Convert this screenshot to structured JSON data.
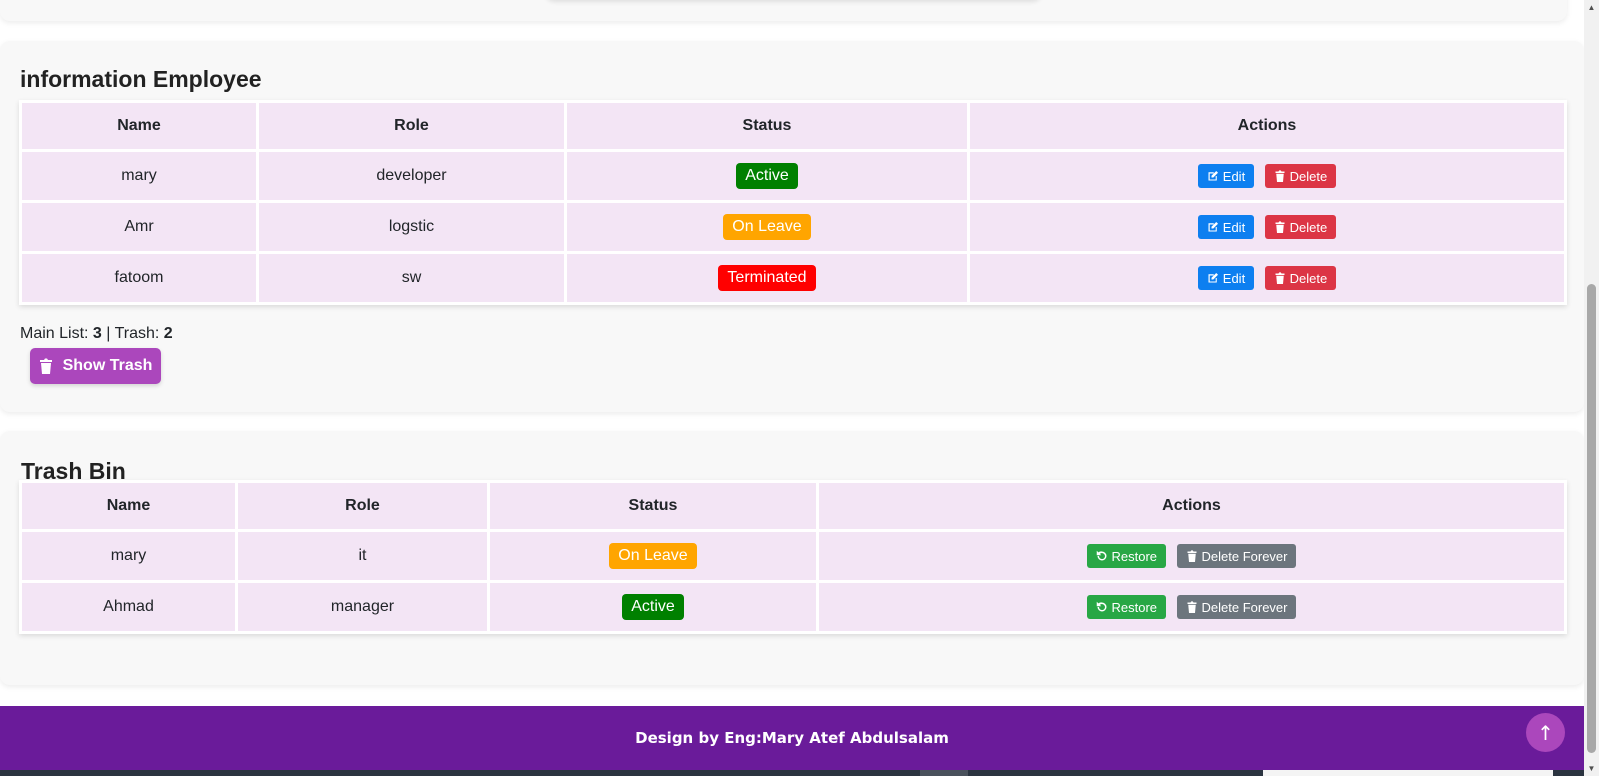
{
  "employee_section": {
    "title": "information Employee",
    "columns": [
      "Name",
      "Role",
      "Status",
      "Actions"
    ],
    "rows": [
      {
        "name": "mary",
        "role": "developer",
        "status": "Active"
      },
      {
        "name": "Amr",
        "role": "logstic",
        "status": "On Leave"
      },
      {
        "name": "fatoom",
        "role": "sw",
        "status": "Terminated"
      }
    ],
    "edit_label": "Edit",
    "delete_label": "Delete"
  },
  "counts": {
    "main_label": "Main List: ",
    "main_value": "3",
    "separator": " | Trash: ",
    "trash_value": "2"
  },
  "show_trash_label": "Show Trash",
  "trash_section": {
    "title": "Trash Bin",
    "columns": [
      "Name",
      "Role",
      "Status",
      "Actions"
    ],
    "rows": [
      {
        "name": "mary",
        "role": "it",
        "status": "On Leave"
      },
      {
        "name": "Ahmad",
        "role": "manager",
        "status": "Active"
      }
    ],
    "restore_label": "Restore",
    "delete_forever_label": "Delete Forever"
  },
  "footer": {
    "text": "Design by Eng:Mary Atef Abdulsalam"
  },
  "scroll_top_label": "↑",
  "colors": {
    "active": "#008000",
    "on_leave": "#ffa500",
    "terminated": "#ff0000",
    "accent": "#ab47bc",
    "footer_bg": "#6a1b9a"
  }
}
